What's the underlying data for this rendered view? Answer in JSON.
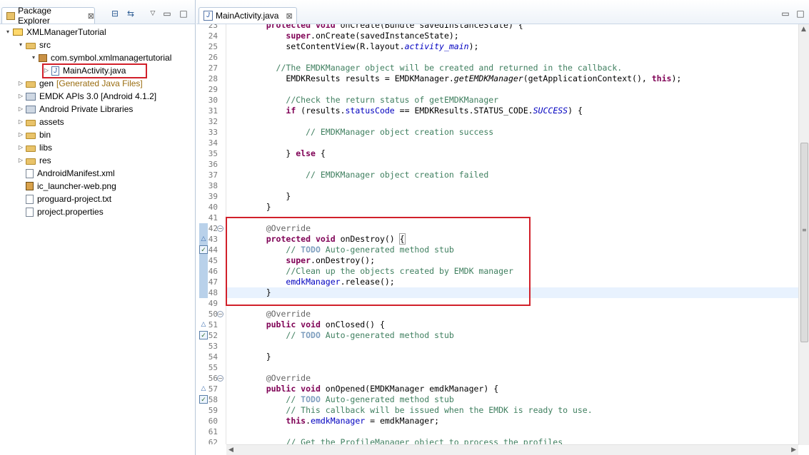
{
  "explorer": {
    "tab_label": "Package Explorer",
    "tab_close": "⊠",
    "toolbar_icons": [
      "collapse-all-icon",
      "link-with-editor-icon",
      "view-menu-icon",
      "minimize-icon",
      "maximize-icon"
    ],
    "items": [
      {
        "label": "XMLManagerTutorial",
        "icon": "project-icon",
        "twisty": "▾",
        "indent": 0
      },
      {
        "label": "src",
        "icon": "source-folder-icon",
        "twisty": "▾",
        "indent": 1
      },
      {
        "label": "com.symbol.xmlmanagertutorial",
        "icon": "package-icon",
        "twisty": "▾",
        "indent": 2
      },
      {
        "label": "MainActivity.java",
        "icon": "java-file-icon",
        "twisty": "▷",
        "indent": 3,
        "selected": true
      },
      {
        "label": "gen",
        "suffix": "[Generated Java Files]",
        "icon": "source-folder-icon",
        "twisty": "▷",
        "indent": 1
      },
      {
        "label": "EMDK APIs 3.0 [Android 4.1.2]",
        "icon": "library-icon",
        "twisty": "▷",
        "indent": 1
      },
      {
        "label": "Android Private Libraries",
        "icon": "library-icon",
        "twisty": "▷",
        "indent": 1
      },
      {
        "label": "assets",
        "icon": "folder-icon",
        "twisty": "▷",
        "indent": 1
      },
      {
        "label": "bin",
        "icon": "folder-icon",
        "twisty": "▷",
        "indent": 1
      },
      {
        "label": "libs",
        "icon": "folder-icon",
        "twisty": "▷",
        "indent": 1
      },
      {
        "label": "res",
        "icon": "folder-icon",
        "twisty": "▷",
        "indent": 1
      },
      {
        "label": "AndroidManifest.xml",
        "icon": "xml-file-icon",
        "twisty": "",
        "indent": 1
      },
      {
        "label": "ic_launcher-web.png",
        "icon": "image-file-icon",
        "twisty": "",
        "indent": 1
      },
      {
        "label": "proguard-project.txt",
        "icon": "text-file-icon",
        "twisty": "",
        "indent": 1
      },
      {
        "label": "project.properties",
        "icon": "text-file-icon",
        "twisty": "",
        "indent": 1
      }
    ]
  },
  "editor": {
    "tab_label": "MainActivity.java",
    "tab_close": "⊠",
    "toolbar_icons": [
      "minimize-icon",
      "maximize-icon"
    ],
    "lines": [
      {
        "n": "23",
        "segs": [
          [
            "    ",
            ""
          ],
          [
            "protected void ",
            "kw"
          ],
          [
            "onCreate(Bundle savedInstanceState) {",
            ""
          ]
        ]
      },
      {
        "n": "24",
        "segs": [
          [
            "        ",
            ""
          ],
          [
            "super",
            "kw"
          ],
          [
            ".onCreate(savedInstanceState);",
            ""
          ]
        ]
      },
      {
        "n": "25",
        "segs": [
          [
            "        setContentView(R.layout.",
            ""
          ],
          [
            "activity_main",
            "field-static"
          ],
          [
            ");",
            ""
          ]
        ]
      },
      {
        "n": "26",
        "segs": [
          [
            "",
            ""
          ]
        ]
      },
      {
        "n": "27",
        "segs": [
          [
            "      ",
            ""
          ],
          [
            "//The EMDKManager object will be created and returned in the callback.",
            "comment"
          ]
        ]
      },
      {
        "n": "28",
        "segs": [
          [
            "        EMDKResults results = EMDKManager.",
            ""
          ],
          [
            "getEMDKManager",
            "method-static"
          ],
          [
            "(getApplicationContext(), ",
            ""
          ],
          [
            "this",
            "kw"
          ],
          [
            ");",
            ""
          ]
        ]
      },
      {
        "n": "29",
        "segs": [
          [
            "",
            ""
          ]
        ]
      },
      {
        "n": "30",
        "segs": [
          [
            "        ",
            ""
          ],
          [
            "//Check the return status of getEMDKManager",
            "comment"
          ]
        ]
      },
      {
        "n": "31",
        "segs": [
          [
            "        ",
            ""
          ],
          [
            "if",
            "kw"
          ],
          [
            " (results.",
            ""
          ],
          [
            "statusCode",
            "field"
          ],
          [
            " == EMDKResults.STATUS_CODE.",
            ""
          ],
          [
            "SUCCESS",
            "field-static"
          ],
          [
            ") {",
            ""
          ]
        ]
      },
      {
        "n": "32",
        "segs": [
          [
            "",
            ""
          ]
        ]
      },
      {
        "n": "33",
        "segs": [
          [
            "            ",
            ""
          ],
          [
            "// EMDKManager object creation success",
            "comment"
          ]
        ]
      },
      {
        "n": "34",
        "segs": [
          [
            "",
            ""
          ]
        ]
      },
      {
        "n": "35",
        "segs": [
          [
            "        } ",
            ""
          ],
          [
            "else",
            "kw"
          ],
          [
            " {",
            ""
          ]
        ]
      },
      {
        "n": "36",
        "segs": [
          [
            "",
            ""
          ]
        ]
      },
      {
        "n": "37",
        "segs": [
          [
            "            ",
            ""
          ],
          [
            "// EMDKManager object creation failed",
            "comment"
          ]
        ]
      },
      {
        "n": "38",
        "segs": [
          [
            "",
            ""
          ]
        ]
      },
      {
        "n": "39",
        "segs": [
          [
            "        }",
            ""
          ]
        ]
      },
      {
        "n": "40",
        "segs": [
          [
            "    }",
            ""
          ]
        ]
      },
      {
        "n": "41",
        "segs": [
          [
            "",
            ""
          ]
        ]
      },
      {
        "n": "42",
        "segs": [
          [
            "    ",
            ""
          ],
          [
            "@Override",
            "annotation"
          ]
        ]
      },
      {
        "n": "43",
        "segs": [
          [
            "    ",
            ""
          ],
          [
            "protected void ",
            "kw"
          ],
          [
            "onDestroy() ",
            ""
          ],
          [
            "{",
            "bracket"
          ]
        ]
      },
      {
        "n": "44",
        "segs": [
          [
            "        ",
            ""
          ],
          [
            "// ",
            "comment"
          ],
          [
            "TODO",
            "todo"
          ],
          [
            " Auto-generated method stub",
            "comment"
          ]
        ]
      },
      {
        "n": "45",
        "segs": [
          [
            "        ",
            ""
          ],
          [
            "super",
            "kw"
          ],
          [
            ".onDestroy();",
            ""
          ]
        ]
      },
      {
        "n": "46",
        "segs": [
          [
            "        ",
            ""
          ],
          [
            "//Clean up the objects created by EMDK manager",
            "comment"
          ]
        ]
      },
      {
        "n": "47",
        "segs": [
          [
            "        ",
            ""
          ],
          [
            "emdkManager",
            "field"
          ],
          [
            ".release();",
            ""
          ]
        ]
      },
      {
        "n": "48",
        "segs": [
          [
            "    }",
            ""
          ]
        ]
      },
      {
        "n": "49",
        "segs": [
          [
            "",
            ""
          ]
        ]
      },
      {
        "n": "50",
        "segs": [
          [
            "    ",
            ""
          ],
          [
            "@Override",
            "annotation"
          ]
        ]
      },
      {
        "n": "51",
        "segs": [
          [
            "    ",
            ""
          ],
          [
            "public void ",
            "kw"
          ],
          [
            "onClosed() {",
            ""
          ]
        ]
      },
      {
        "n": "52",
        "segs": [
          [
            "        ",
            ""
          ],
          [
            "// ",
            "comment"
          ],
          [
            "TODO",
            "todo"
          ],
          [
            " Auto-generated method stub",
            "comment"
          ]
        ]
      },
      {
        "n": "53",
        "segs": [
          [
            "",
            ""
          ]
        ]
      },
      {
        "n": "54",
        "segs": [
          [
            "    }",
            ""
          ]
        ]
      },
      {
        "n": "55",
        "segs": [
          [
            "",
            ""
          ]
        ]
      },
      {
        "n": "56",
        "segs": [
          [
            "    ",
            ""
          ],
          [
            "@Override",
            "annotation"
          ]
        ]
      },
      {
        "n": "57",
        "segs": [
          [
            "    ",
            ""
          ],
          [
            "public void ",
            "kw"
          ],
          [
            "onOpened(EMDKManager emdkManager) {",
            ""
          ]
        ]
      },
      {
        "n": "58",
        "segs": [
          [
            "        ",
            ""
          ],
          [
            "// ",
            "comment"
          ],
          [
            "TODO",
            "todo"
          ],
          [
            " Auto-generated method stub",
            "comment"
          ]
        ]
      },
      {
        "n": "59",
        "segs": [
          [
            "        ",
            ""
          ],
          [
            "// This callback will be issued when the EMDK is ready to use.",
            "comment"
          ]
        ]
      },
      {
        "n": "60",
        "segs": [
          [
            "        ",
            ""
          ],
          [
            "this",
            "kw"
          ],
          [
            ".",
            ""
          ],
          [
            "emdkManager",
            "field"
          ],
          [
            " = emdkManager;",
            ""
          ]
        ]
      },
      {
        "n": "61",
        "segs": [
          [
            "",
            ""
          ]
        ]
      },
      {
        "n": "62",
        "segs": [
          [
            "        ",
            ""
          ],
          [
            "// Get the ProfileManager object to process the profiles",
            "comment"
          ]
        ]
      }
    ],
    "highlighted_line": "48",
    "fold_markers": [
      "42",
      "50",
      "56"
    ],
    "override_markers": [
      "43",
      "51",
      "57"
    ],
    "task_markers": [
      "44",
      "52",
      "58"
    ]
  },
  "colors": {
    "keyword": "#7f0055",
    "comment": "#3f7f5f",
    "todo": "#7f9fbf",
    "field": "#0000c0",
    "annotation": "#646464",
    "accent_red": "#d1202a"
  }
}
